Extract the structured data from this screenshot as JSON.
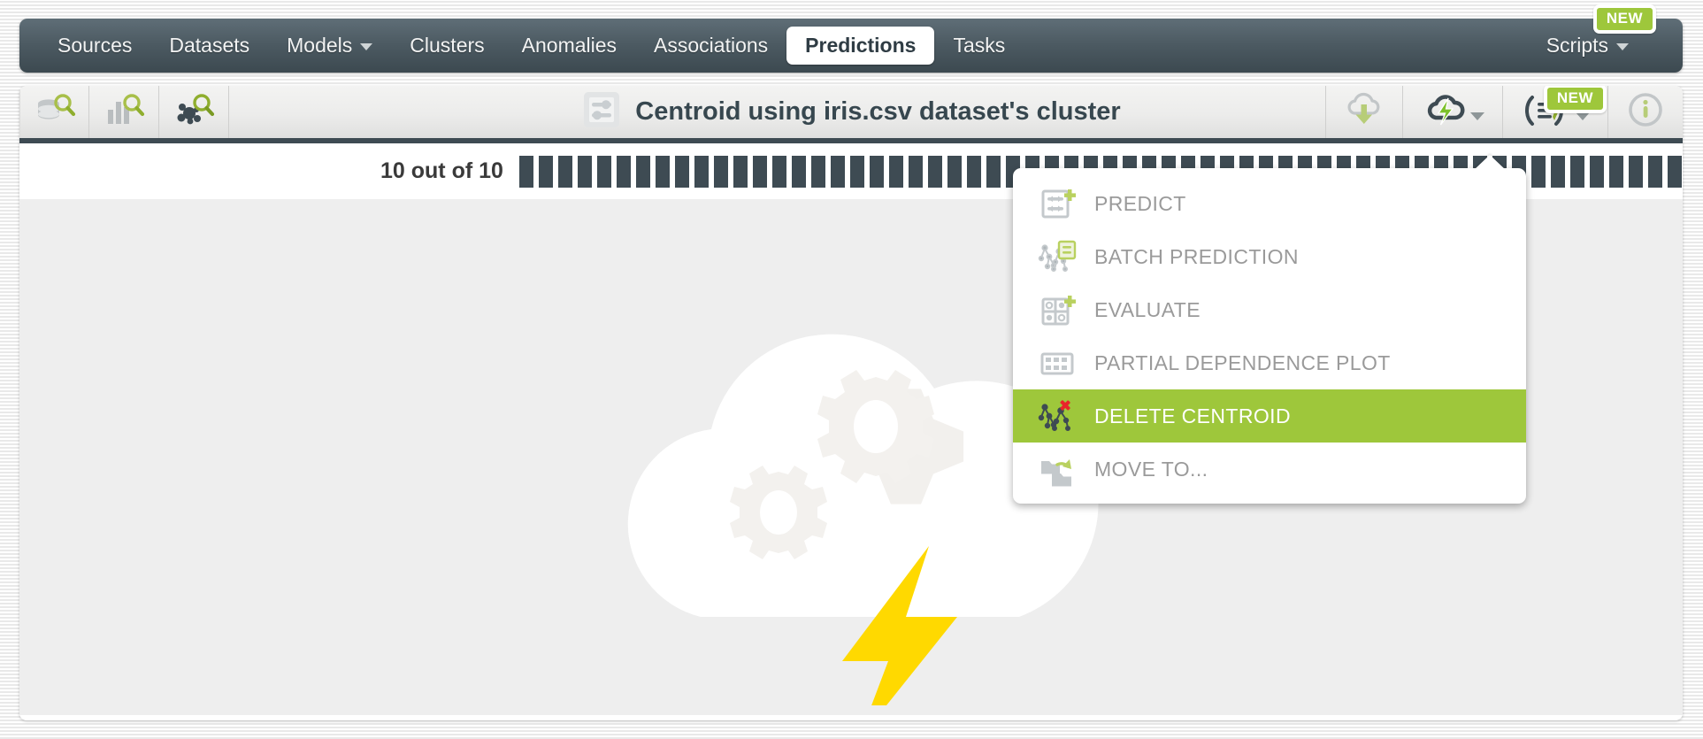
{
  "navbar": {
    "items": [
      {
        "label": "Sources",
        "has_caret": false,
        "active": false
      },
      {
        "label": "Datasets",
        "has_caret": false,
        "active": false
      },
      {
        "label": "Models",
        "has_caret": true,
        "active": false
      },
      {
        "label": "Clusters",
        "has_caret": false,
        "active": false
      },
      {
        "label": "Anomalies",
        "has_caret": false,
        "active": false
      },
      {
        "label": "Associations",
        "has_caret": false,
        "active": false
      },
      {
        "label": "Predictions",
        "has_caret": false,
        "active": true
      },
      {
        "label": "Tasks",
        "has_caret": false,
        "active": false
      }
    ],
    "right": {
      "label": "Scripts",
      "badge": "NEW"
    }
  },
  "toolbar": {
    "left_buttons": [
      {
        "icon": "dataset-search-icon",
        "label": "Sources search"
      },
      {
        "icon": "chart-search-icon",
        "label": "Datasets search"
      },
      {
        "icon": "cluster-search-icon",
        "label": "Clusters search"
      }
    ],
    "title": "Centroid using iris.csv dataset's cluster",
    "title_icon": "centroid-sliders-icon",
    "right_buttons": [
      {
        "icon": "download-cloud-icon",
        "label": "Download"
      },
      {
        "icon": "actions-lightning-icon",
        "label": "Actions",
        "has_caret": true
      },
      {
        "icon": "api-request-icon",
        "label": "API request preview",
        "has_caret": true,
        "badge": "NEW"
      },
      {
        "icon": "info-icon",
        "label": "Info"
      }
    ]
  },
  "progress": {
    "label": "10 out of 10",
    "current": 10,
    "total": 10,
    "percent": 100
  },
  "menu": {
    "items": [
      {
        "label": "PREDICT",
        "icon": "predict-icon",
        "highlight": false
      },
      {
        "label": "BATCH PREDICTION",
        "icon": "batch-prediction-icon",
        "highlight": false
      },
      {
        "label": "EVALUATE",
        "icon": "evaluate-icon",
        "highlight": false
      },
      {
        "label": "PARTIAL DEPENDENCE PLOT",
        "icon": "partial-dependence-plot-icon",
        "highlight": false
      },
      {
        "label": "DELETE CENTROID",
        "icon": "delete-centroid-icon",
        "highlight": true
      },
      {
        "label": "MOVE TO...",
        "icon": "move-to-folder-icon",
        "highlight": false
      }
    ]
  },
  "content": {
    "placeholder_icon": "cloud-gears-lightning-illustration"
  },
  "colors": {
    "navbar_top": "#5f6e77",
    "navbar_bottom": "#3c4950",
    "accent_green": "#9ec73b",
    "dark_slate": "#3e4b53",
    "lightning_yellow": "#ffd700",
    "text_muted": "#9a9a9a"
  }
}
